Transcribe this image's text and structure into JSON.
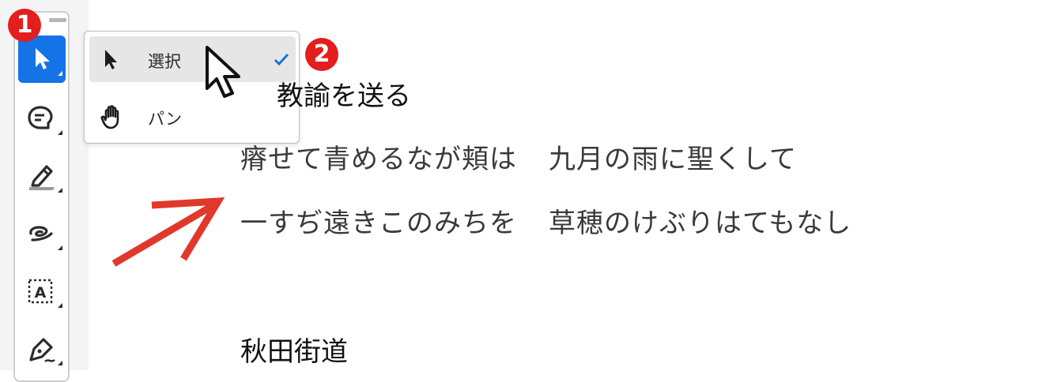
{
  "toolbar": {
    "tools": [
      {
        "name": "select-tool",
        "icon": "arrow-pointer-icon",
        "active": true
      },
      {
        "name": "comment-tool",
        "icon": "comment-bubble-icon",
        "active": false
      },
      {
        "name": "highlight-tool",
        "icon": "highlighter-icon",
        "active": false
      },
      {
        "name": "draw-tool",
        "icon": "freehand-draw-icon",
        "active": false
      },
      {
        "name": "text-box-tool",
        "icon": "text-box-icon",
        "active": false
      },
      {
        "name": "signature-tool",
        "icon": "pen-sign-icon",
        "active": false
      }
    ],
    "active_color": "#1473e6"
  },
  "flyout": {
    "items": [
      {
        "label": "選択",
        "icon": "arrow-pointer-icon",
        "checked": true
      },
      {
        "label": "パン",
        "icon": "hand-icon",
        "checked": false
      }
    ]
  },
  "badges": {
    "one": "1",
    "two": "2",
    "color": "#e41e1e"
  },
  "document": {
    "heading_1_visible": "教諭を送る",
    "verse_1": {
      "left": "瘠せて青めるなが頬は",
      "right": "九月の雨に聖くして"
    },
    "verse_2": {
      "left": "一すぢ遠きこのみちを",
      "right": "草穂のけぶりはてもなし"
    },
    "heading_2": "秋田街道"
  },
  "annotation_arrow_color": "#e0392b"
}
